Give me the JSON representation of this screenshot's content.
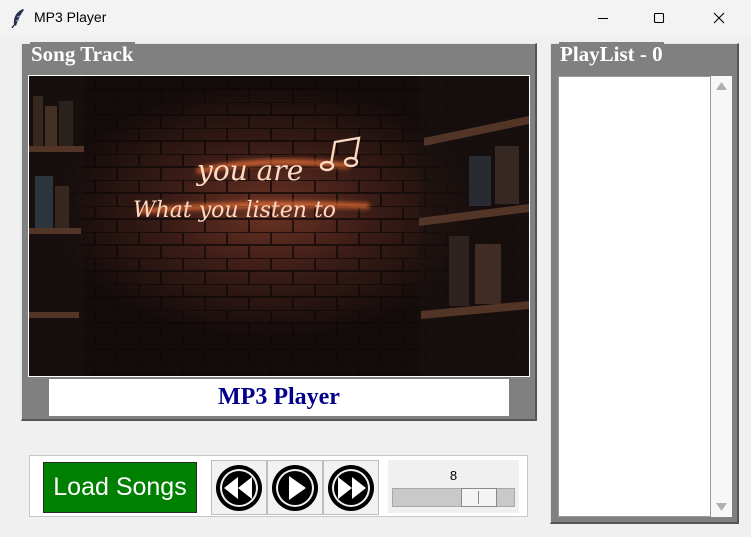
{
  "window": {
    "title": "MP3 Player",
    "icons": [
      "feather-icon",
      "minimize-icon",
      "maximize-icon",
      "close-icon"
    ]
  },
  "song_track": {
    "frame_label": "Song Track",
    "artwork_text": [
      "you are",
      "What you listen to"
    ],
    "status_text": "MP3 Player"
  },
  "controls": {
    "load_label": "Load Songs",
    "buttons": [
      "rewind-icon",
      "play-icon",
      "fast-forward-icon"
    ],
    "volume_value": "8"
  },
  "playlist": {
    "label": "PlayList - 0",
    "items": []
  },
  "colors": {
    "frame": "#808080",
    "load_button": "#008000",
    "status_text": "#00008b",
    "neon": "#ffd8c0"
  }
}
